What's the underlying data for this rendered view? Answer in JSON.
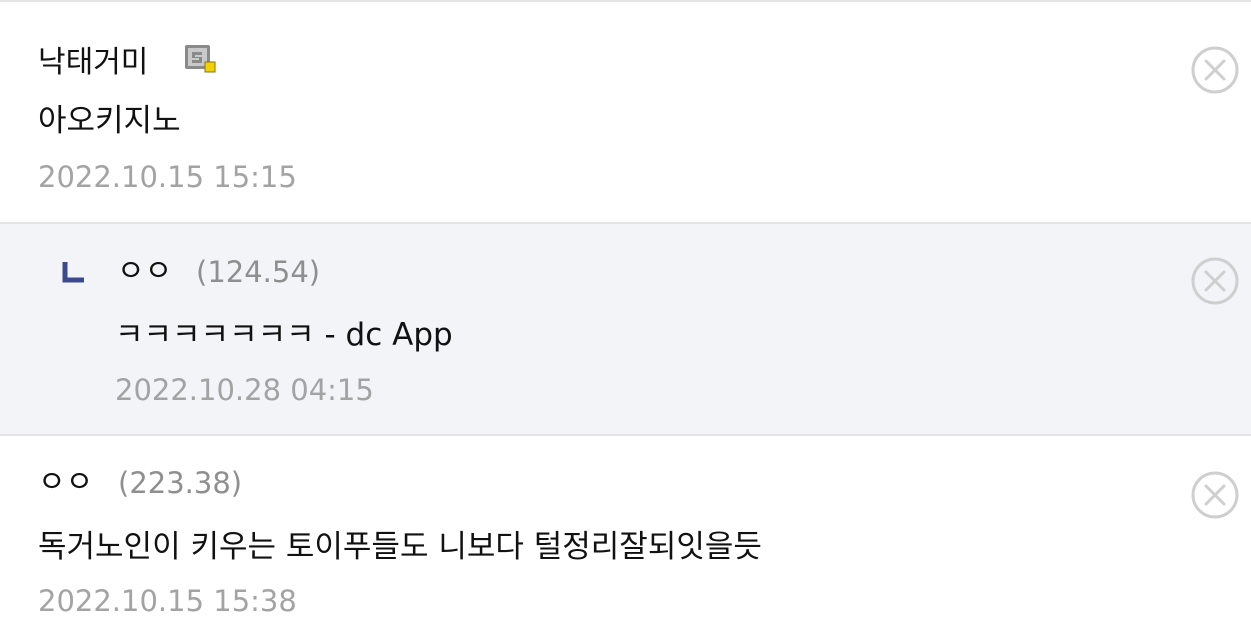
{
  "comments": [
    {
      "author": "낙태거미",
      "author_badge_icon": "gallery-nickname-icon",
      "text": "아오키지노",
      "date": "2022.10.15 15:15",
      "delete_icon": "circle-x-icon"
    },
    {
      "is_reply": true,
      "reply_marker_icon": "reply-corner-icon",
      "author": "ㅇㅇ",
      "ip": "(124.54)",
      "text": "ㅋㅋㅋㅋㅋㅋㅋ - dc App",
      "date": "2022.10.28 04:15",
      "delete_icon": "circle-x-icon"
    },
    {
      "author": "ㅇㅇ",
      "ip": "(223.38)",
      "text": "독거노인이 키우는 토이푸들도 니보다 털정리잘되잇을듯",
      "date": "2022.10.15 15:38",
      "delete_icon": "circle-x-icon"
    }
  ],
  "colors": {
    "reply_background": "#f3f4f8",
    "reply_marker": "#3b4a8c",
    "meta_text": "#a3a3a3",
    "divider": "#e4e4e4"
  }
}
